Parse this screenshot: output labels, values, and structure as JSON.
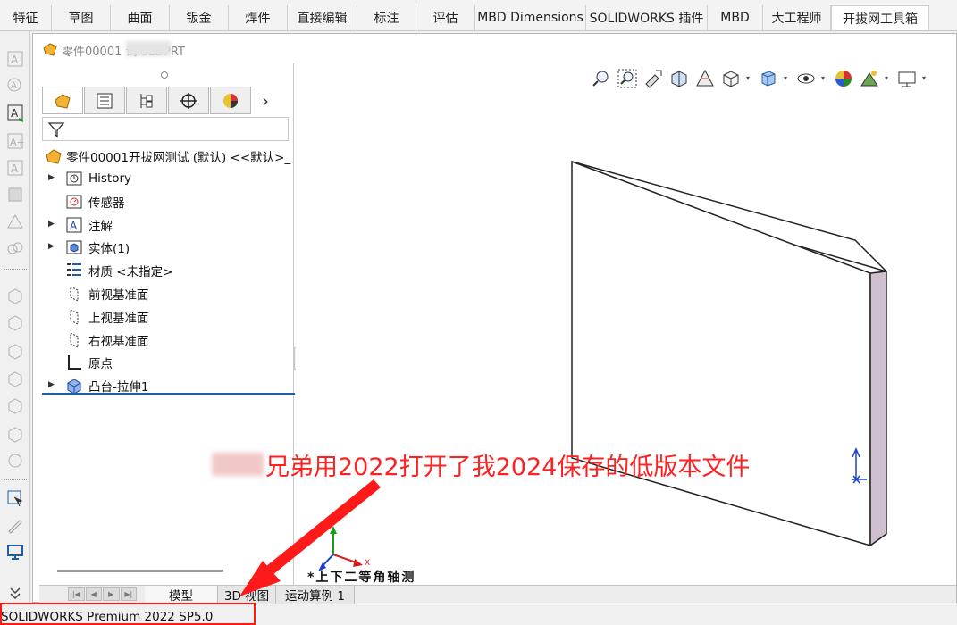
{
  "ribbon": {
    "tabs": [
      {
        "label": "特征",
        "width": 58
      },
      {
        "label": "草图",
        "width": 66
      },
      {
        "label": "曲面",
        "width": 66
      },
      {
        "label": "钣金",
        "width": 66
      },
      {
        "label": "焊件",
        "width": 66
      },
      {
        "label": "直接编辑",
        "width": 78
      },
      {
        "label": "标注",
        "width": 66
      },
      {
        "label": "评估",
        "width": 66
      },
      {
        "label": "MBD Dimensions",
        "width": 124
      },
      {
        "label": "SOLIDWORKS 插件",
        "width": 136
      },
      {
        "label": "MBD",
        "width": 62
      },
      {
        "label": "大工程师",
        "width": 76
      },
      {
        "label": "开拔网工具箱",
        "width": 110,
        "active": true
      }
    ]
  },
  "document": {
    "title": "零件00001 试.SLDPRT"
  },
  "feature_tree": {
    "root_label": "零件00001开拔网测试 (默认) <<默认>_",
    "items": [
      {
        "label": "History",
        "icon": "history-icon",
        "expandable": true
      },
      {
        "label": "传感器",
        "icon": "sensor-icon",
        "expandable": false
      },
      {
        "label": "注解",
        "icon": "annotation-icon",
        "expandable": true
      },
      {
        "label": "实体(1)",
        "icon": "solid-bodies-icon",
        "expandable": true
      },
      {
        "label": "材质 <未指定>",
        "icon": "material-icon",
        "expandable": false
      },
      {
        "label": "前视基准面",
        "icon": "plane-icon",
        "expandable": false
      },
      {
        "label": "上视基准面",
        "icon": "plane-icon",
        "expandable": false
      },
      {
        "label": "右视基准面",
        "icon": "plane-icon",
        "expandable": false
      },
      {
        "label": "原点",
        "icon": "origin-icon",
        "expandable": false
      },
      {
        "label": "凸台-拉伸1",
        "icon": "boss-extrude-icon",
        "expandable": true
      }
    ]
  },
  "bottom_tabs": [
    {
      "label": "模型"
    },
    {
      "label": "3D 视图"
    },
    {
      "label": "运动算例 1"
    }
  ],
  "graphics": {
    "view_label": "*上下二等角轴测",
    "triad": {
      "y": "Y",
      "x": "X"
    }
  },
  "annotation": {
    "text": "兄弟用2022打开了我2024保存的低版本文件"
  },
  "status_bar": {
    "text": "SOLIDWORKS Premium 2022 SP5.0"
  },
  "colors": {
    "accent_blue": "#1d5fa6",
    "annotation_red": "#ff2020",
    "part_side": "#cfc0cf",
    "chevron": "›"
  }
}
